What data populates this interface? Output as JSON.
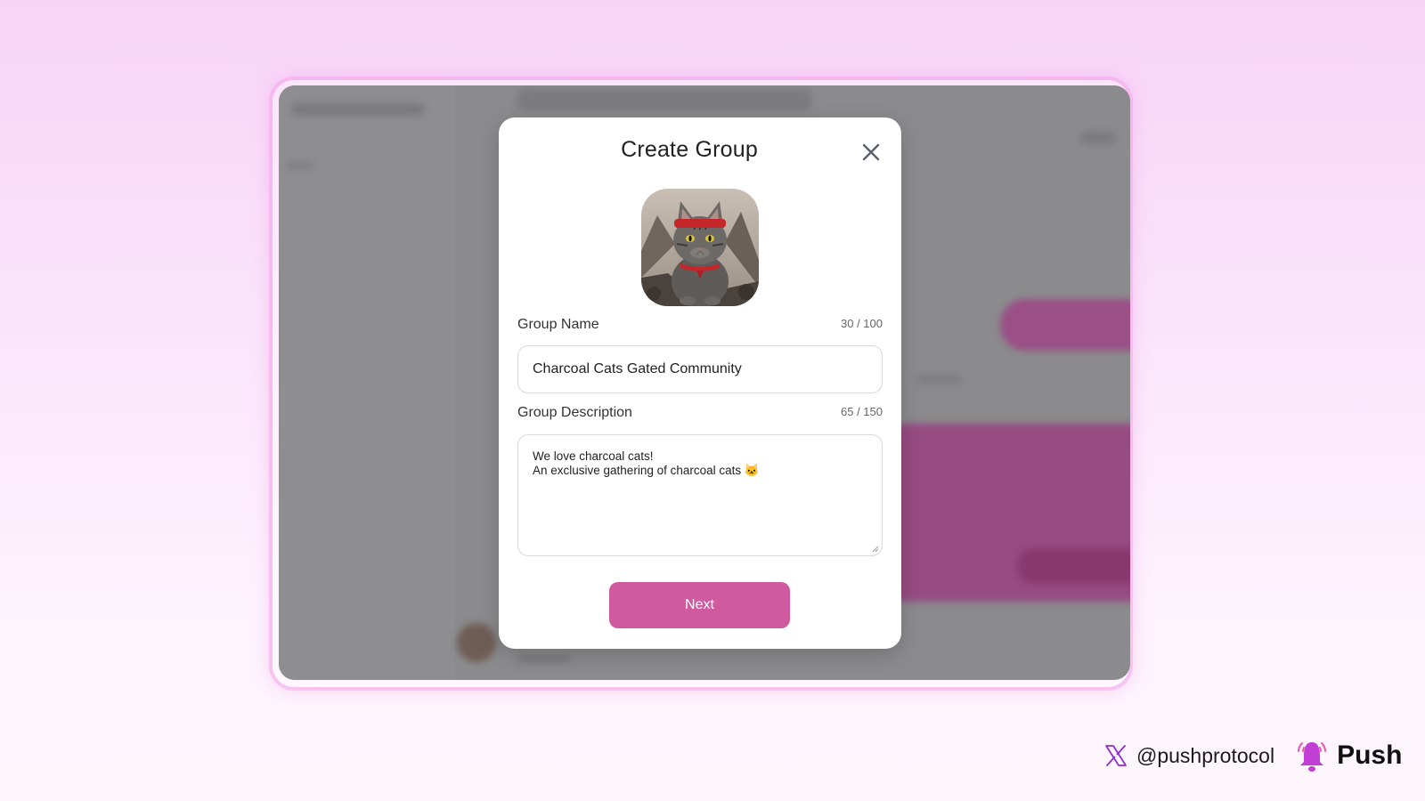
{
  "modal": {
    "title": "Create Group",
    "group_name": {
      "label": "Group Name",
      "counter": "30 / 100",
      "value": "Charcoal Cats Gated Community"
    },
    "group_description": {
      "label": "Group Description",
      "counter": "65 / 150",
      "line1": "We love charcoal cats!",
      "line2": "An exclusive gathering of charcoal cats 🐱"
    },
    "next_label": "Next"
  },
  "footer": {
    "handle": "@pushprotocol",
    "brand": "Push"
  },
  "colors": {
    "accent": "#d05a9f",
    "brand_bell": "#c23fd6"
  },
  "icons": [
    "close-icon",
    "group-avatar-cat",
    "x-logo-icon",
    "push-bell-icon"
  ]
}
